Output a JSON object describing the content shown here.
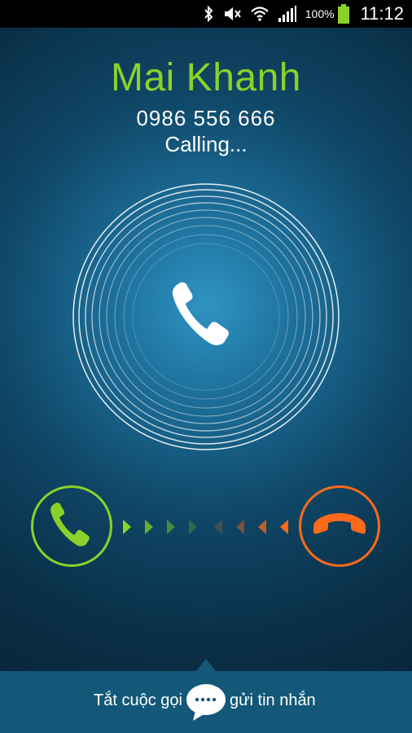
{
  "status_bar": {
    "battery_percent": "100%",
    "time": "11:12",
    "icons": [
      "bluetooth-icon",
      "mute-icon",
      "wifi-icon",
      "signal-icon",
      "battery-icon"
    ]
  },
  "call": {
    "contact_name": "Mai Khanh",
    "phone_number": "0986 556 666",
    "status": "Calling..."
  },
  "controls": {
    "answer_icon": "phone-answer-icon",
    "decline_icon": "phone-decline-icon",
    "center_icon": "phone-handset-icon"
  },
  "bottom_bar": {
    "reject_label": "Tắt cuộc gọi",
    "send_message_label": "gửi tin nhắn",
    "message_icon": "message-bubble-icon"
  },
  "colors": {
    "accent_green": "#8bd12a",
    "accent_orange": "#ff6a1a",
    "bottom_bar": "#135879"
  }
}
